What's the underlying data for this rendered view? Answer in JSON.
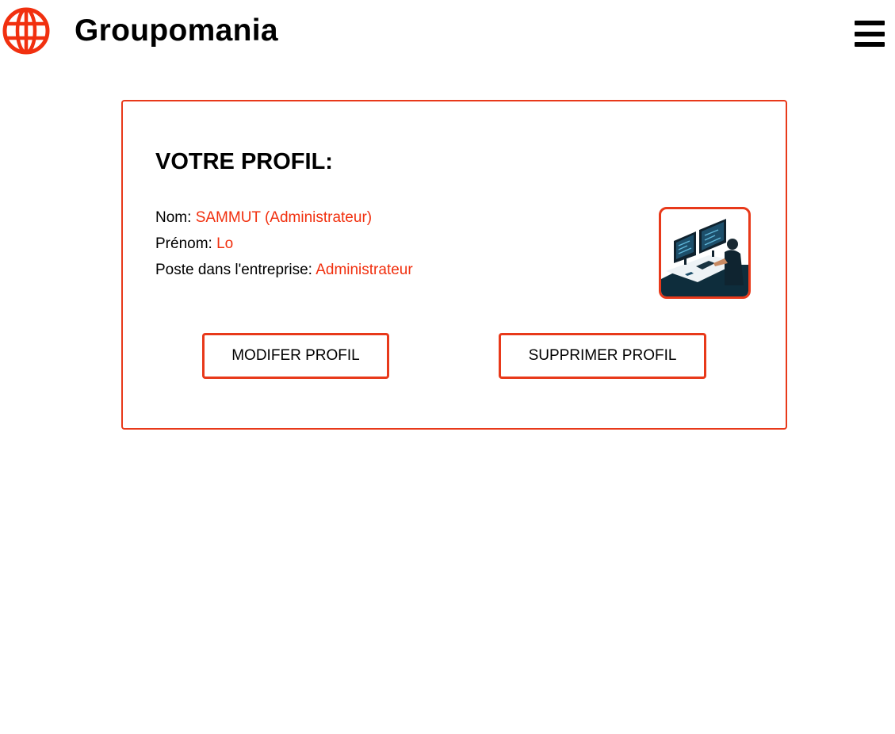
{
  "header": {
    "brand": "Groupomania",
    "logo_icon": "globe-icon",
    "menu_icon": "hamburger-menu-icon"
  },
  "colors": {
    "accent": "#e8391a",
    "value_text": "#f1300f"
  },
  "profile": {
    "title": "VOTRE PROFIL:",
    "fields": [
      {
        "label": "Nom:",
        "value": "SAMMUT (Administrateur)"
      },
      {
        "label": "Prénom:",
        "value": "Lo"
      },
      {
        "label": "Poste dans l'entreprise:",
        "value": "Administrateur"
      }
    ],
    "avatar": "developer-at-desk-illustration"
  },
  "actions": {
    "edit_label": "MODIFER PROFIL",
    "delete_label": "SUPPRIMER PROFIL"
  }
}
